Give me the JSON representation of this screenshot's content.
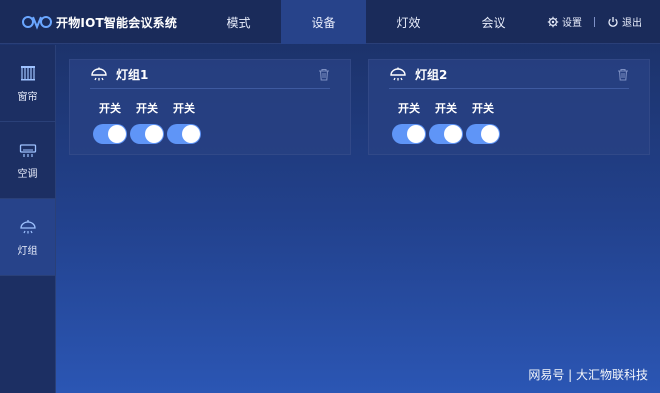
{
  "app": {
    "title": "开物IOT智能会议系统"
  },
  "nav": {
    "items": [
      {
        "label": "模式"
      },
      {
        "label": "设备"
      },
      {
        "label": "灯效"
      },
      {
        "label": "会议"
      }
    ],
    "active_index": 1
  },
  "actions": {
    "settings": "设置",
    "logout": "退出"
  },
  "sidebar": {
    "items": [
      {
        "label": "窗帘",
        "icon": "curtain-icon"
      },
      {
        "label": "空调",
        "icon": "air-conditioner-icon"
      },
      {
        "label": "灯组",
        "icon": "lamp-icon"
      }
    ],
    "active_index": 2
  },
  "groups": [
    {
      "title": "灯组1",
      "switches": [
        {
          "label": "开关",
          "on": true
        },
        {
          "label": "开关",
          "on": true
        },
        {
          "label": "开关",
          "on": true
        }
      ]
    },
    {
      "title": "灯组2",
      "switches": [
        {
          "label": "开关",
          "on": true
        },
        {
          "label": "开关",
          "on": true
        },
        {
          "label": "开关",
          "on": true
        }
      ]
    }
  ],
  "watermark": "网易号 | 大汇物联科技",
  "colors": {
    "topbar": "#1a2b5a",
    "active_nav": "#27438a",
    "toggle_on": "#5f95f7"
  }
}
